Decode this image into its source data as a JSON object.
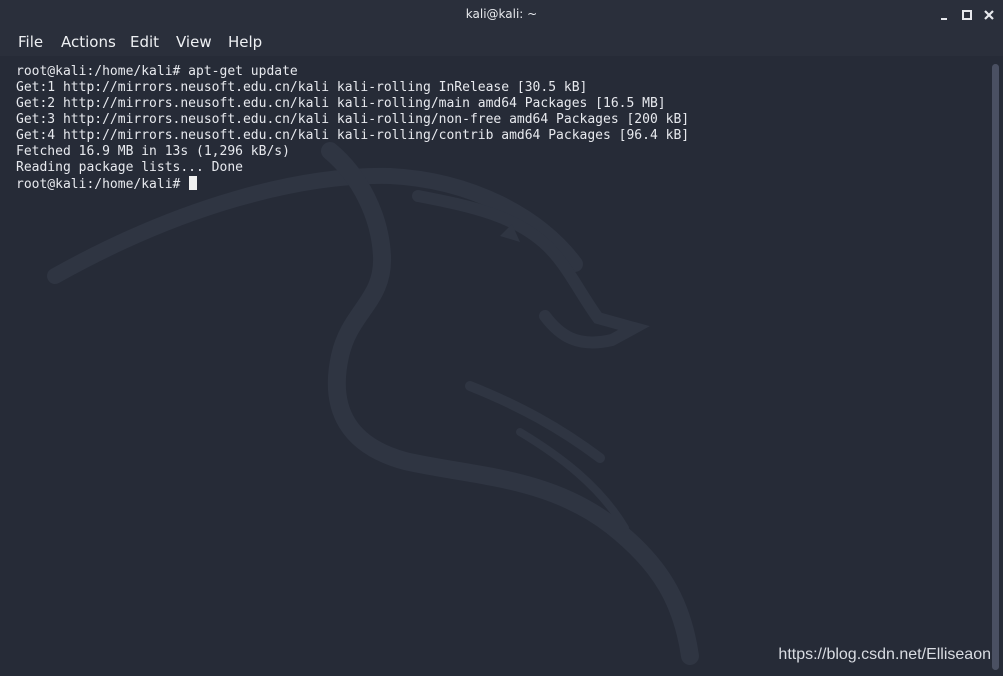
{
  "window": {
    "title": "kali@kali: ~"
  },
  "menubar": {
    "items": [
      "File",
      "Actions",
      "Edit",
      "View",
      "Help"
    ]
  },
  "terminal": {
    "lines": [
      "root@kali:/home/kali# apt-get update",
      "Get:1 http://mirrors.neusoft.edu.cn/kali kali-rolling InRelease [30.5 kB]",
      "Get:2 http://mirrors.neusoft.edu.cn/kali kali-rolling/main amd64 Packages [16.5 MB]",
      "Get:3 http://mirrors.neusoft.edu.cn/kali kali-rolling/non-free amd64 Packages [200 kB]",
      "Get:4 http://mirrors.neusoft.edu.cn/kali kali-rolling/contrib amd64 Packages [96.4 kB]",
      "Fetched 16.9 MB in 13s (1,296 kB/s)",
      "Reading package lists... Done"
    ],
    "prompt": "root@kali:/home/kali# "
  },
  "watermark": {
    "text": "https://blog.csdn.net/Elliseaon"
  },
  "icons": {
    "minimize": "minimize-icon",
    "maximize": "maximize-icon",
    "close": "close-icon"
  },
  "colors": {
    "background": "#262b37",
    "text": "#e7e9ee",
    "dragon": "#2f3542"
  }
}
